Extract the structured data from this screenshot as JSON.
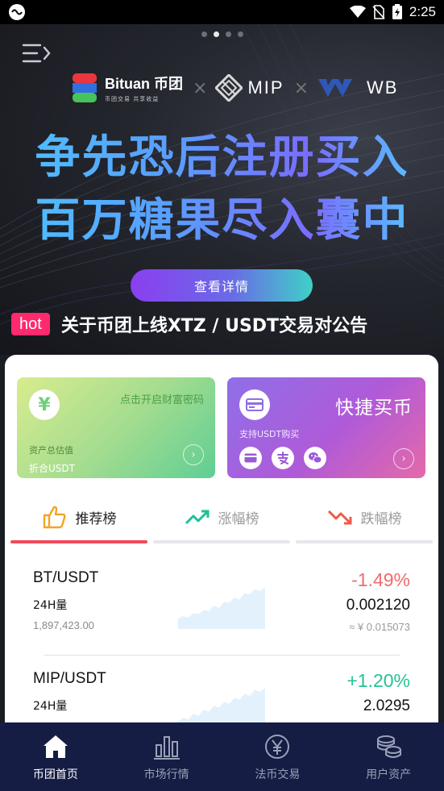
{
  "status_bar": {
    "time": "2:25"
  },
  "banner": {
    "partners": {
      "bituan_name": "Bituan 币团",
      "bituan_sub": "币团交易 共享收益",
      "mip": "MIP",
      "wb": "WB",
      "separator": "×"
    },
    "headline_1": "争先恐后注册买入",
    "headline_2": "百万糖果尽入囊中",
    "detail_button": "查看详情",
    "notice_badge": "hot",
    "notice_text": "关于币团上线XTZ / USDT交易对公告"
  },
  "cards": {
    "assets": {
      "icon_glyph": "¥",
      "tip": "点击开启财富密码",
      "label": "资产总估值",
      "sub": "折合USDT"
    },
    "quick_buy": {
      "title": "快捷买币",
      "sub": "支持USDT购买"
    }
  },
  "tabs": [
    {
      "label": "推荐榜",
      "icon": "thumbs-up-icon"
    },
    {
      "label": "涨幅榜",
      "icon": "trend-up-icon"
    },
    {
      "label": "跌幅榜",
      "icon": "trend-down-icon"
    }
  ],
  "coins": [
    {
      "pair": "BT/USDT",
      "volume_label": "24H量",
      "volume": "1,897,423.00",
      "change": "-1.49%",
      "price": "0.002120",
      "cny": "≈ ¥ 0.015073",
      "sparkline": [
        10,
        12,
        11,
        15,
        14,
        18,
        17,
        22,
        20,
        26,
        25,
        30,
        28,
        34,
        33,
        38,
        36,
        40
      ]
    },
    {
      "pair": "MIP/USDT",
      "volume_label": "24H量",
      "volume": "",
      "change": "+1.20%",
      "price": "2.0295",
      "cny": "",
      "sparkline": [
        8,
        12,
        10,
        16,
        14,
        20,
        18,
        24,
        22,
        28,
        26,
        32,
        30,
        36,
        34,
        40,
        38,
        42
      ]
    }
  ],
  "bottom_nav": [
    {
      "label": "币团首页",
      "icon": "home-icon",
      "active": true
    },
    {
      "label": "市场行情",
      "icon": "bar-chart-icon",
      "active": false
    },
    {
      "label": "法币交易",
      "icon": "yen-coin-icon",
      "active": false
    },
    {
      "label": "用户资产",
      "icon": "coins-stack-icon",
      "active": false
    }
  ],
  "colors": {
    "down": "#f06b6b",
    "up": "#25c295",
    "accent_tab": "#f04a5a",
    "nav_bg": "#161d44",
    "hot_badge": "#ff2a6d"
  }
}
